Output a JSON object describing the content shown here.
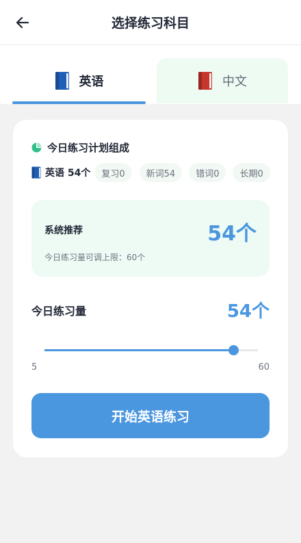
{
  "header": {
    "title": "选择练习科目"
  },
  "tabs": [
    {
      "label": "英语",
      "active": true,
      "icon": "blue-book-icon"
    },
    {
      "label": "中文",
      "active": false,
      "icon": "red-book-icon"
    }
  ],
  "plan": {
    "title": "今日练习计划组成",
    "subject": "英语 54个",
    "chips": [
      "复习0",
      "新词54",
      "错词0",
      "长期0"
    ]
  },
  "recommend": {
    "title": "系统推荐",
    "value": "54个",
    "note": "今日练习量可调上限：60个"
  },
  "today": {
    "label": "今日练习量",
    "value": "54个"
  },
  "slider": {
    "min": "5",
    "max": "60",
    "value": 54
  },
  "start_button": "开始英语练习",
  "colors": {
    "accent": "#4a96df",
    "mint": "#eefbf3",
    "pie_green": "#2fbf8a",
    "book_blue": "#1e5fb5",
    "book_red": "#c7362e"
  }
}
